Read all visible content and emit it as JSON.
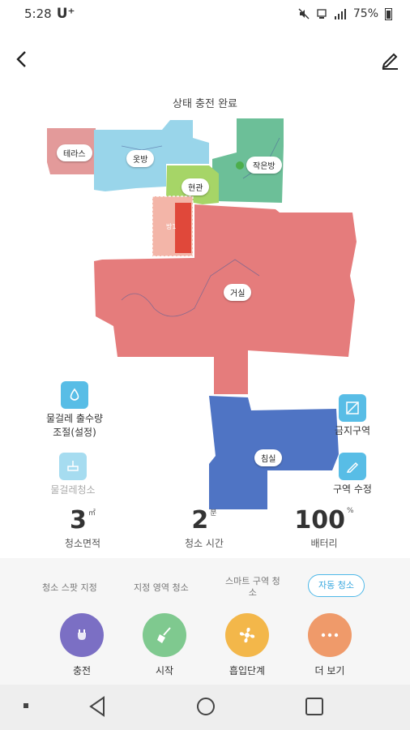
{
  "status_bar": {
    "time": "5:28",
    "carrier": "U⁺",
    "battery_percent": "75%"
  },
  "header": {
    "back_icon": "back-arrow-icon",
    "edit_icon": "pencil-icon"
  },
  "map": {
    "status_text": "상태 충전 완료",
    "rooms": [
      {
        "label": "테라스",
        "color": "#e39a9a"
      },
      {
        "label": "옷방",
        "color": "#99d5ea"
      },
      {
        "label": "작은방",
        "color": "#6cbf98"
      },
      {
        "label": "현관",
        "color": "#a6d567"
      },
      {
        "label": "거실",
        "color": "#e57c7c"
      },
      {
        "label": "침실",
        "color": "#4f74c4"
      }
    ],
    "marker_label": "방1",
    "marker_color": "#e0483a"
  },
  "side_controls": {
    "water_flow_label": "물걸레 출수량\n조절(설정)",
    "mop_clean_label": "물걸레청소",
    "no_go_zone_label": "금지구역",
    "edit_zone_label": "구역 수정"
  },
  "stats": {
    "area_value": "3",
    "area_unit": "㎡",
    "area_label": "청소면적",
    "time_value": "2",
    "time_unit": "분",
    "time_label": "청소 시간",
    "battery_value": "100",
    "battery_unit": "%",
    "battery_label": "배터리"
  },
  "modes": {
    "spot": "청소 스팟 지정",
    "zone": "지정 영역 청소",
    "smart_line1": "스마트 구역 청",
    "smart_line2": "소",
    "auto": "자동 청소"
  },
  "actions": {
    "charge": {
      "label": "충전",
      "color": "#7b6fc4"
    },
    "start": {
      "label": "시작",
      "color": "#7fc98f"
    },
    "suction": {
      "label": "흡입단계",
      "color": "#f3b74a"
    },
    "more": {
      "label": "더 보기",
      "color": "#ef9a6a"
    }
  },
  "accent_color": "#4fb8e8"
}
